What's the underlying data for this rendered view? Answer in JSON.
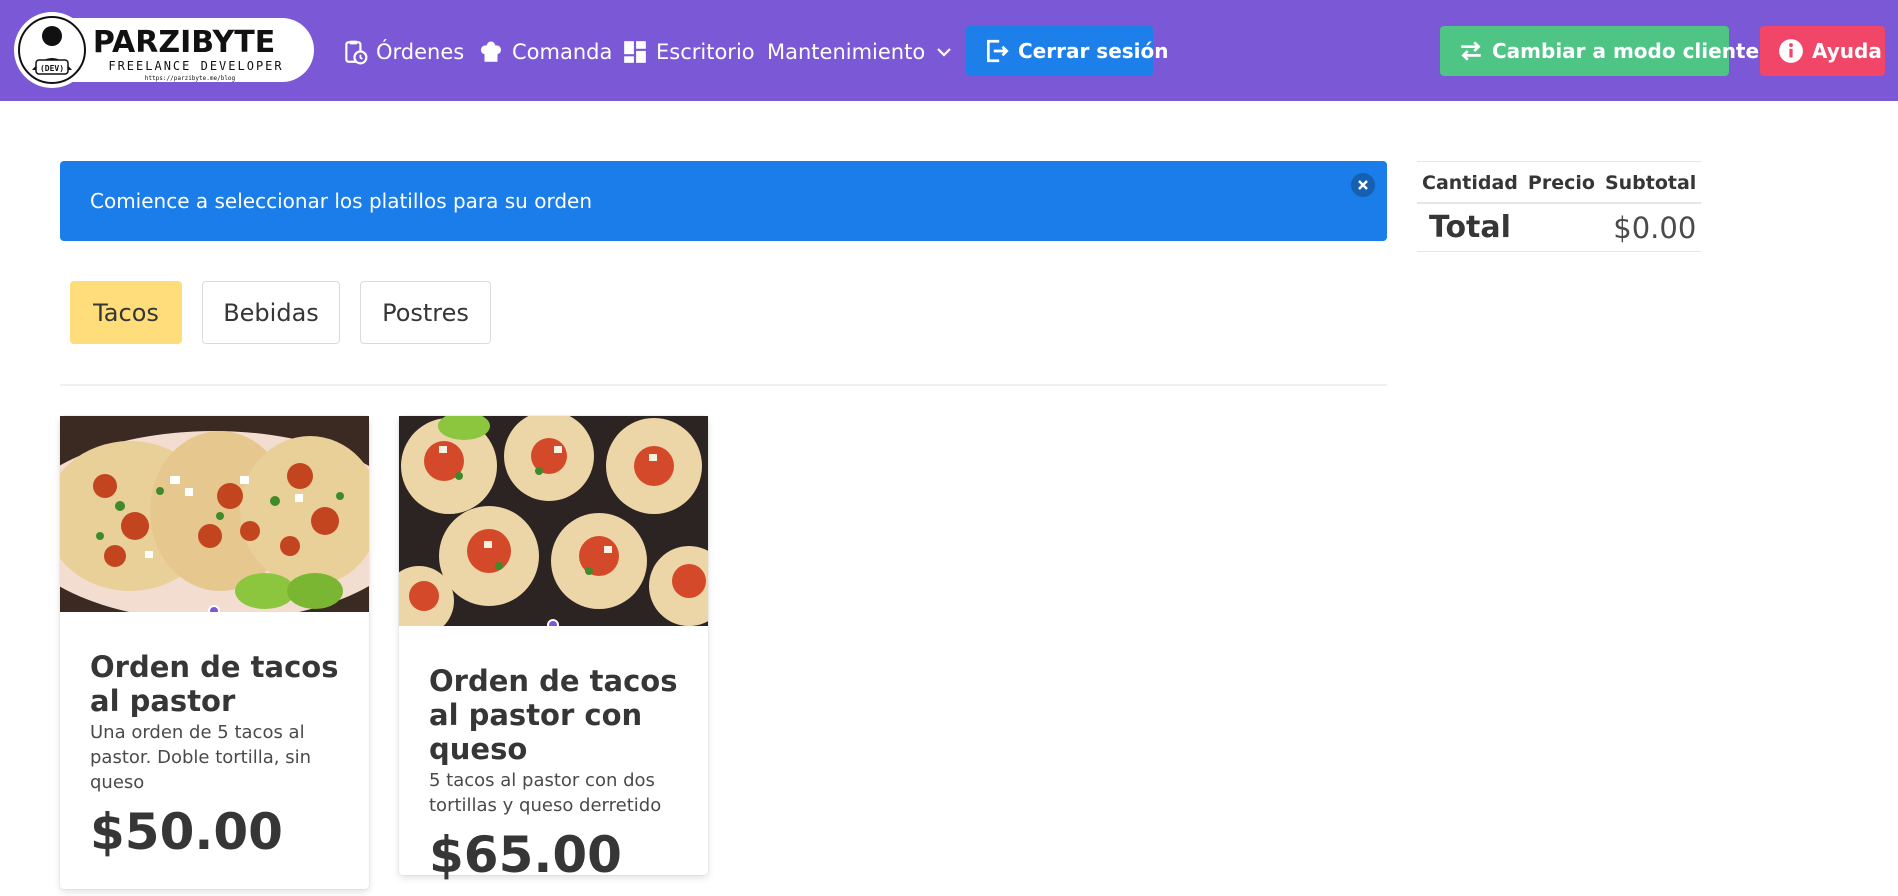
{
  "navbar": {
    "logo": {
      "name": "PARZIBYTE",
      "subtitle": "FREELANCE DEVELOPER",
      "url": "https://parzibyte.me/blog",
      "badge": "(DEV)"
    },
    "links": [
      {
        "label": "Órdenes",
        "icon": "clipboard-clock-icon"
      },
      {
        "label": "Comanda",
        "icon": "chef-hat-icon"
      },
      {
        "label": "Escritorio",
        "icon": "dashboard-icon"
      },
      {
        "label": "Mantenimiento",
        "icon": "chevron-down-icon"
      }
    ],
    "logout": {
      "label": "Cerrar sesión",
      "icon": "logout-icon"
    },
    "client_mode": {
      "label": "Cambiar a modo cliente",
      "icon": "swap-arrows-icon"
    },
    "help": {
      "label": "Ayuda",
      "icon": "info-circle-icon"
    }
  },
  "notification": {
    "message": "Comience a seleccionar los platillos para su orden"
  },
  "tabs": [
    {
      "label": "Tacos",
      "active": true
    },
    {
      "label": "Bebidas",
      "active": false
    },
    {
      "label": "Postres",
      "active": false
    }
  ],
  "products": [
    {
      "title": "Orden de tacos al pastor",
      "description": "Una orden de 5 tacos al pastor. Doble tortilla, sin queso",
      "price": "$50.00"
    },
    {
      "title": "Orden de tacos al pastor con queso",
      "description": "5 tacos al pastor con dos tortillas y queso derretido",
      "price": "$65.00"
    }
  ],
  "order_table": {
    "headers": [
      "Cantidad",
      "Precio",
      "Subtotal"
    ],
    "total_label": "Total",
    "total_value": "$0.00"
  },
  "colors": {
    "navbar": "#7b58d6",
    "logout": "#1d80ea",
    "client_mode": "#4ec585",
    "help": "#f14668",
    "notification": "#1a7de9",
    "active_tab": "#ffdd7a"
  }
}
